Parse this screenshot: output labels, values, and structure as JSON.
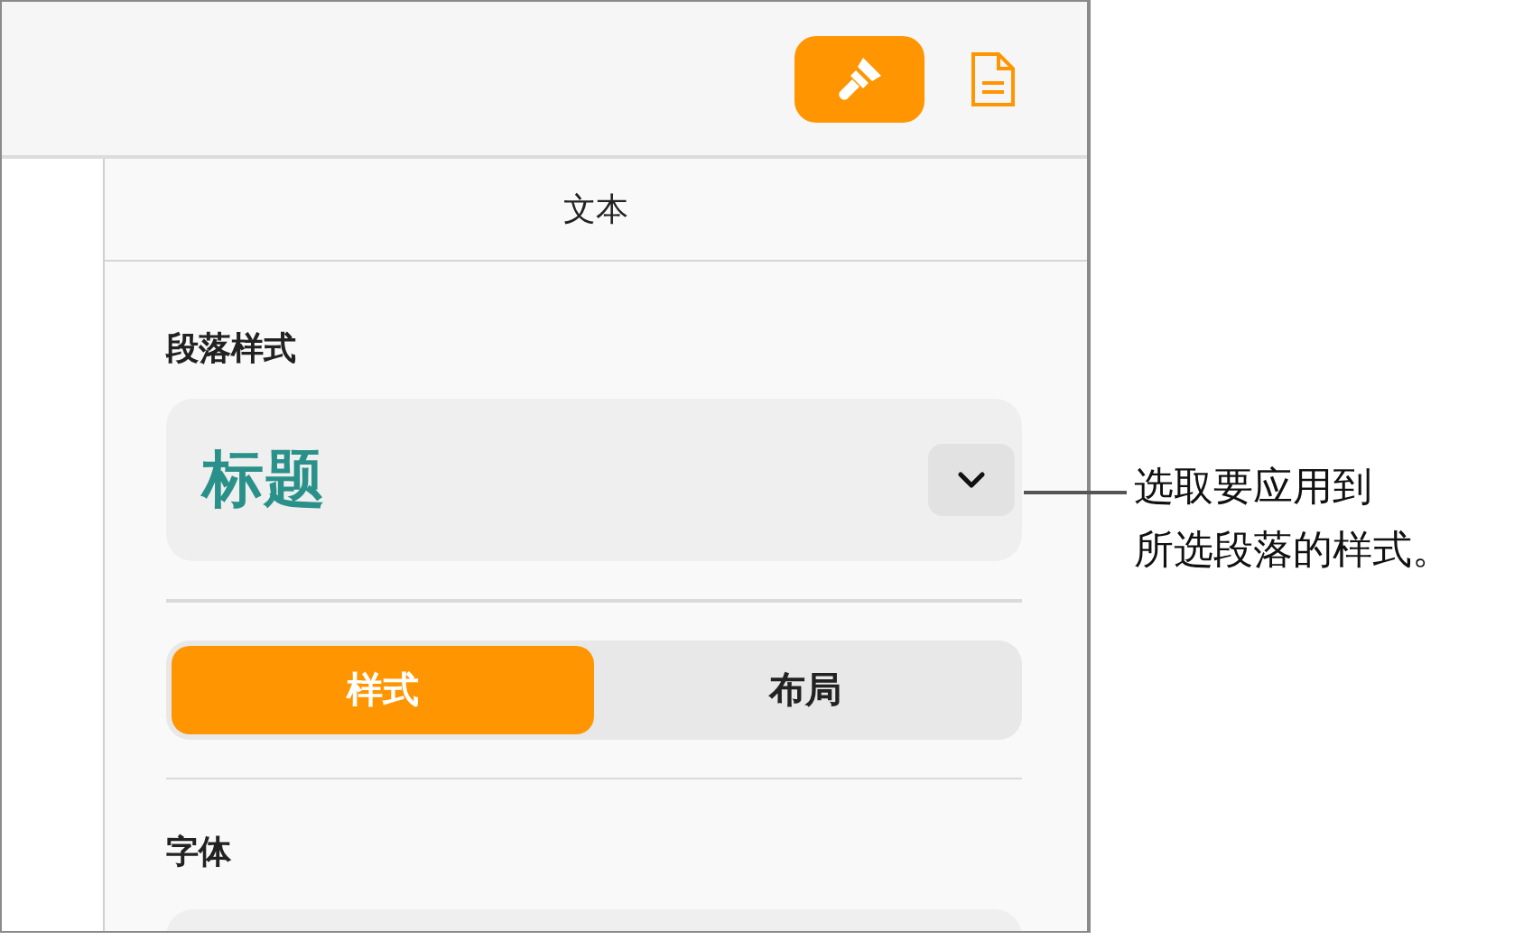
{
  "toolbar": {
    "buttons": [
      {
        "kind": "format",
        "selected": true
      },
      {
        "kind": "document",
        "selected": false
      }
    ]
  },
  "sidebar": {
    "header": "文本",
    "paragraph_style": {
      "label": "段落样式",
      "value": "标题"
    },
    "tabs": [
      {
        "label": "样式",
        "selected": true
      },
      {
        "label": "布局",
        "selected": false
      }
    ],
    "font": {
      "label": "字体"
    }
  },
  "callout": {
    "lines": [
      "选取要应用到",
      "所选段落的样式。"
    ]
  }
}
